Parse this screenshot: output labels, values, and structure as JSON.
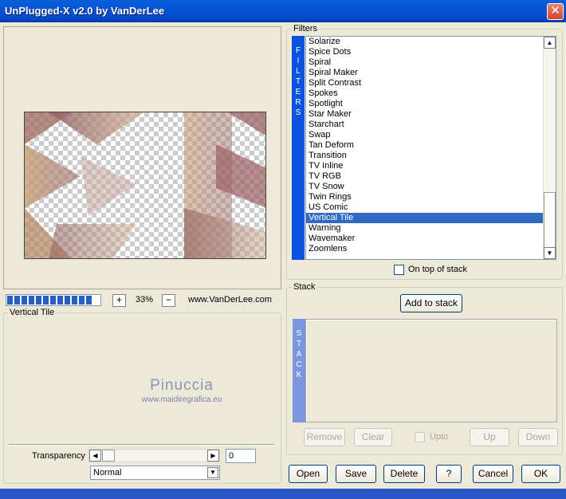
{
  "window": {
    "title": "UnPlugged-X v2.0 by VanDerLee",
    "close_glyph": "✕"
  },
  "preview": {
    "zoom_out_label": "+",
    "zoom_value": "33%",
    "zoom_in_label": "−",
    "website": "www.VanDerLee.com",
    "progress_blocks": 12
  },
  "filter_settings": {
    "group_label": "Vertical Tile",
    "watermark_line1": "Pinuccia",
    "watermark_line2": "www.maidiregrafica.eu",
    "transparency_label": "Transparency",
    "transparency_value": "0",
    "blend_mode": "Normal"
  },
  "filters": {
    "group_label": "Filters",
    "side_label": "FILTERS",
    "items": [
      "Solarize",
      "Spice Dots",
      "Spiral",
      "Spiral Maker",
      "Split Contrast",
      "Spokes",
      "Spotlight",
      "Star Maker",
      "Starchart",
      "Swap",
      "Tan Deform",
      "Transition",
      "TV Inline",
      "TV RGB",
      "TV Snow",
      "Twin Rings",
      "US Comic",
      "Vertical Tile",
      "Warning",
      "Wavemaker",
      "Zoomlens"
    ],
    "selected": "Vertical Tile",
    "on_top_label": "On top of stack"
  },
  "stack": {
    "group_label": "Stack",
    "side_label": "STACK",
    "add_button": "Add to stack",
    "remove_button": "Remove",
    "clear_button": "Clear",
    "upto_label": "Upto",
    "up_button": "Up",
    "down_button": "Down"
  },
  "footer": {
    "open": "Open",
    "save": "Save",
    "delete": "Delete",
    "help": "?",
    "cancel": "Cancel",
    "ok": "OK"
  },
  "colors": {
    "titlebar": "#0454d6",
    "filters_bar": "#0b52e0",
    "stack_bar": "#7b96de",
    "selection": "#316ac5",
    "dialog_bg": "#ece9d8"
  }
}
